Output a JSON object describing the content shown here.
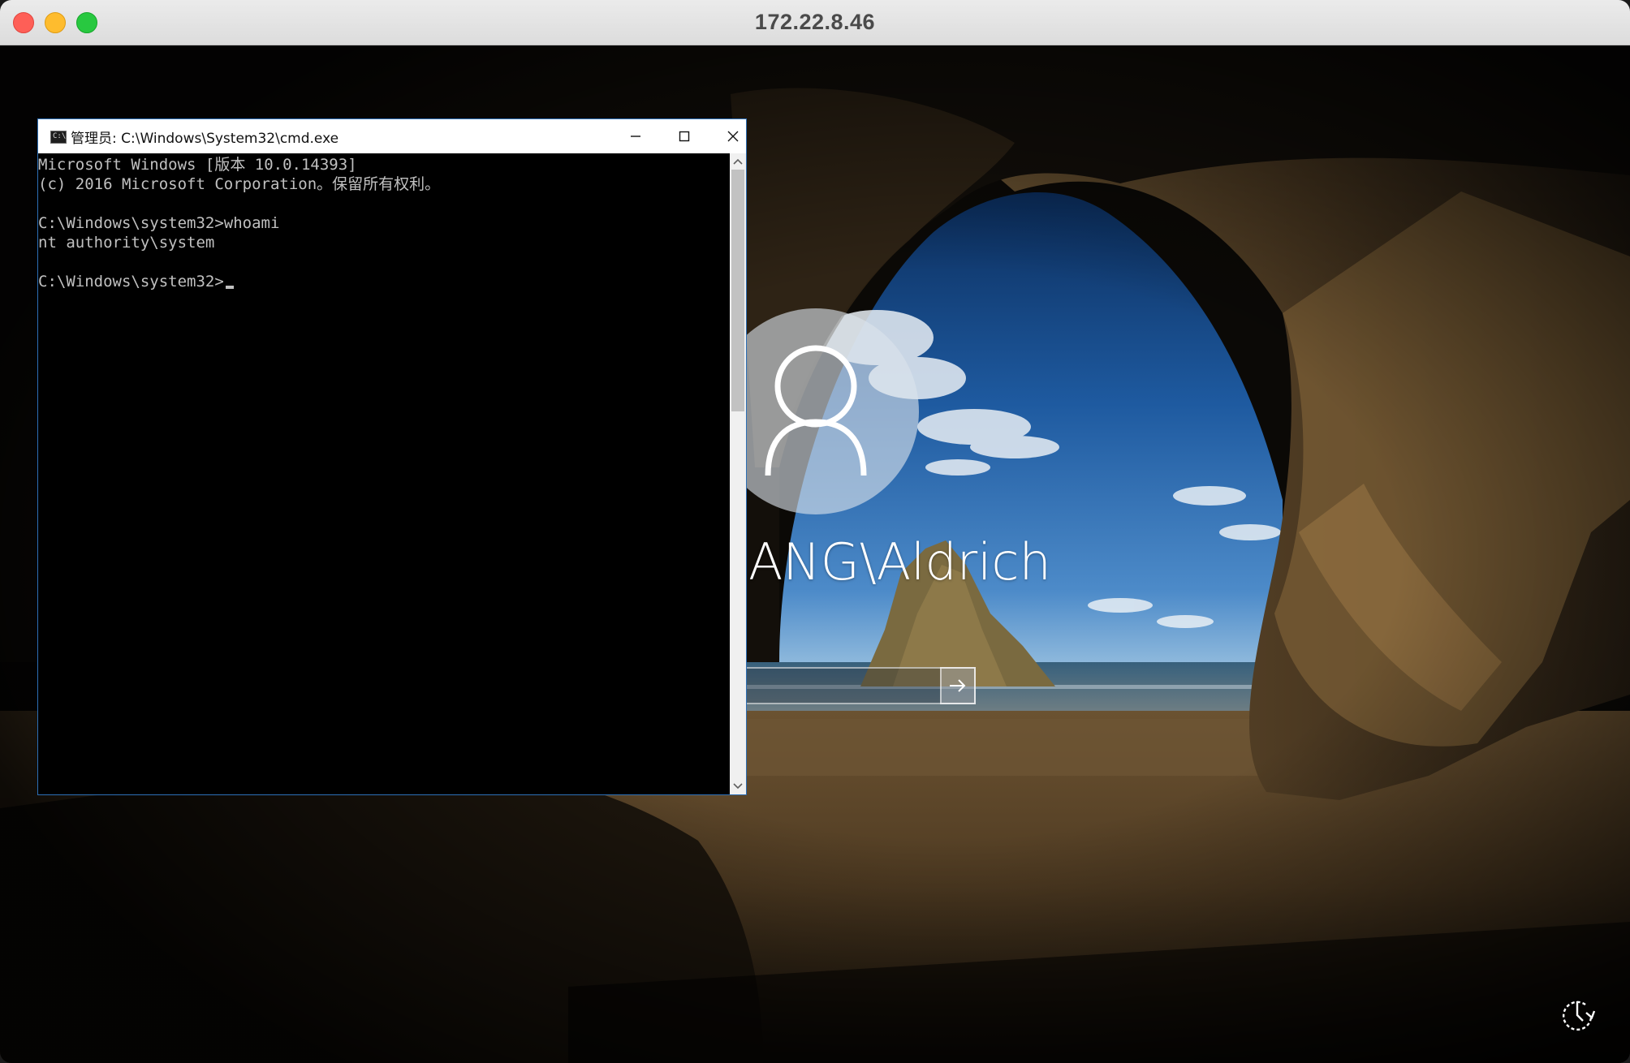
{
  "mac_window": {
    "title": "172.22.8.46"
  },
  "lock_screen": {
    "user_name": "ANG\\Aldrich",
    "avatar_icon": "user-icon",
    "submit_icon": "arrow-right-icon",
    "ease_of_access_icon": "ease-of-access-icon"
  },
  "cmd": {
    "title": "管理员: C:\\Windows\\System32\\cmd.exe",
    "icon": "cmd-icon",
    "icon_glyph": "C:\\",
    "lines": [
      "Microsoft Windows [版本 10.0.14393]",
      "(c) 2016 Microsoft Corporation。保留所有权利。",
      "",
      "C:\\Windows\\system32>whoami",
      "nt authority\\system",
      "",
      "C:\\Windows\\system32>"
    ]
  }
}
